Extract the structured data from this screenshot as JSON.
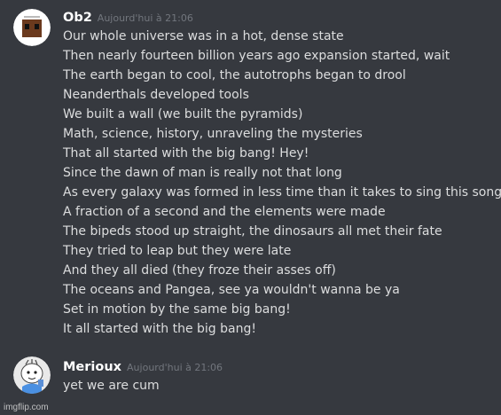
{
  "messages": [
    {
      "username": "Ob2",
      "timestamp": "Aujourd'hui à 21:06",
      "avatar_icon": "brown-robot-face-avatar",
      "lines": [
        "Our whole universe was in a hot, dense state",
        "Then nearly fourteen billion years ago expansion started, wait",
        "The earth began to cool, the autotrophs began to drool",
        "Neanderthals developed tools",
        "We built a wall (we built the pyramids)",
        "Math, science, history, unraveling the mysteries",
        "That all started with the big bang! Hey!",
        "Since the dawn of man is really not that long",
        "As every galaxy was formed in less time than it takes to sing this song",
        "A fraction of a second and the elements were made",
        "The bipeds stood up straight, the dinosaurs all met their fate",
        "They tried to leap but they were late",
        "And they all died (they froze their asses off)",
        "The oceans and Pangea, see ya wouldn't wanna be ya",
        "Set in motion by the same big bang!",
        "It all started with the big bang!"
      ]
    },
    {
      "username": "Merioux",
      "timestamp": "Aujourd'hui à 21:06",
      "avatar_icon": "white-cartoon-character-avatar",
      "lines": [
        "yet we are cum"
      ]
    }
  ],
  "watermark": "imgflip.com",
  "colors": {
    "background": "#36393f",
    "username": "#ffffff",
    "timestamp": "#72767d",
    "message_text": "#dcddde"
  }
}
